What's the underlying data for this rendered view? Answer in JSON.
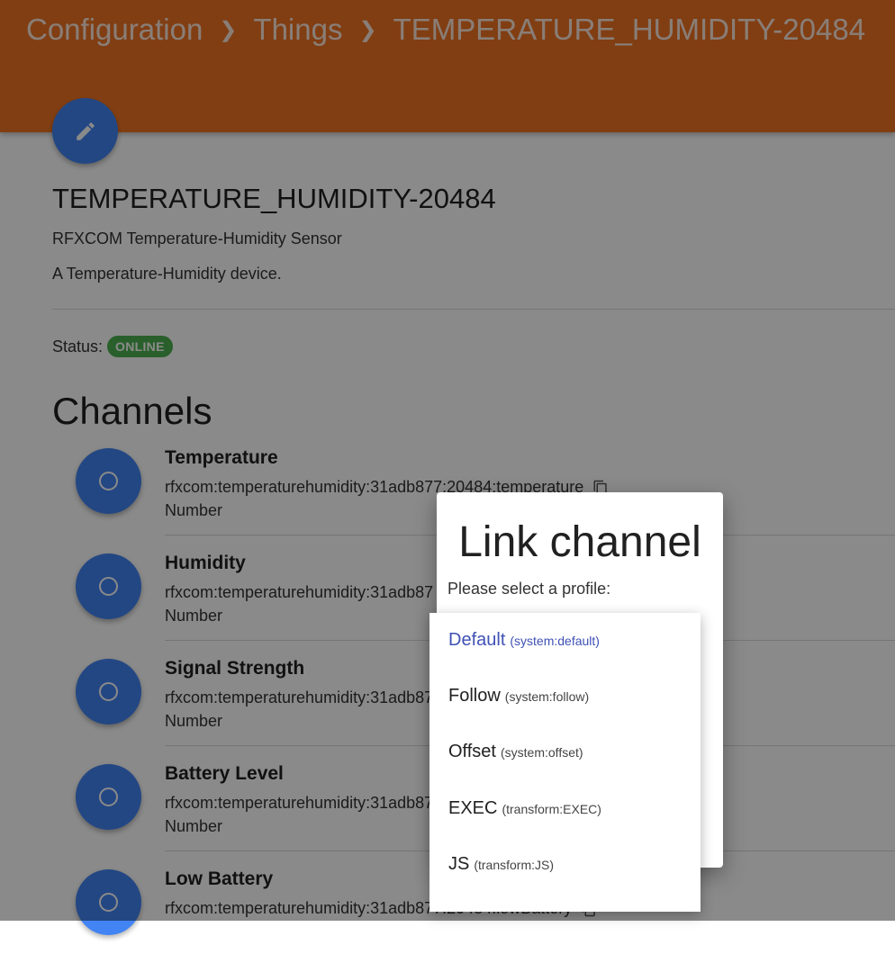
{
  "header": {
    "breadcrumb": [
      "Configuration",
      "Things",
      "TEMPERATURE_HUMIDITY-20484"
    ]
  },
  "thing": {
    "title": "TEMPERATURE_HUMIDITY-20484",
    "label": "RFXCOM Temperature-Humidity Sensor",
    "description": "A Temperature-Humidity device.",
    "status_label": "Status:",
    "status": "ONLINE"
  },
  "channels_section": {
    "title": "Channels",
    "items": [
      {
        "name": "Temperature",
        "uid": "rfxcom:temperaturehumidity:31adb877:20484:temperature",
        "type": "Number"
      },
      {
        "name": "Humidity",
        "uid": "rfxcom:temperaturehumidity:31adb87",
        "type": "Number"
      },
      {
        "name": "Signal Strength",
        "uid": "rfxcom:temperaturehumidity:31adb87",
        "type": "Number"
      },
      {
        "name": "Battery Level",
        "uid": "rfxcom:temperaturehumidity:31adb87",
        "type": "Number"
      },
      {
        "name": "Low Battery",
        "uid": "rfxcom:temperaturehumidity:31adb877:20484:lowBattery",
        "type": ""
      }
    ]
  },
  "dialog": {
    "title": "Link channel",
    "prompt": "Please select a profile:",
    "options": [
      {
        "name": "Default",
        "id": "(system:default)",
        "selected": true
      },
      {
        "name": "Follow",
        "id": "(system:follow)"
      },
      {
        "name": "Offset",
        "id": "(system:offset)"
      },
      {
        "name": "EXEC",
        "id": "(transform:EXEC)"
      },
      {
        "name": "JS",
        "id": "(transform:JS)"
      }
    ]
  },
  "colors": {
    "header": "#ef7423",
    "accent": "#4284f3",
    "status_online": "#4caf50",
    "selected_option": "#3f51b5"
  },
  "icons": {
    "edit": "pencil-icon",
    "channel": "ring-icon",
    "copy": "copy-icon",
    "breadcrumb_separator": "chevron-right-icon"
  }
}
